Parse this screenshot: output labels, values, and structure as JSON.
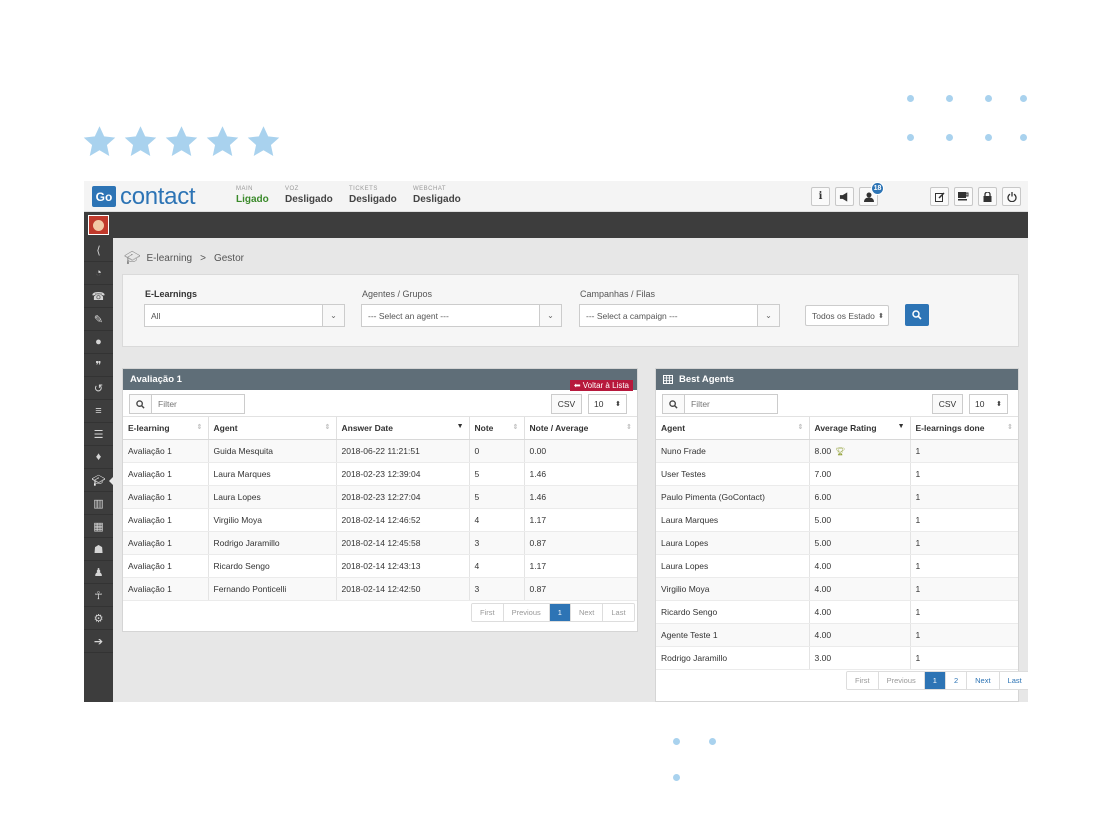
{
  "rating": {
    "stars": 5
  },
  "app": {
    "logo_badge": "Go",
    "logo_text": "contact",
    "statuses": [
      {
        "key": "MAIN",
        "value": "Ligado"
      },
      {
        "key": "VOZ",
        "value": "Desligado"
      },
      {
        "key": "TICKETS",
        "value": "Desligado"
      },
      {
        "key": "WEBCHAT",
        "value": "Desligado"
      }
    ],
    "toolbar": {
      "info_icon": "i",
      "notification_count": "18"
    },
    "accent": "#2d74b5"
  },
  "breadcrumb": {
    "root": "E-learning",
    "sep": ">",
    "current": "Gestor"
  },
  "filters": {
    "elearnings": {
      "label": "E-Learnings",
      "value": "All"
    },
    "agents": {
      "label": "Agentes / Grupos",
      "value": "--- Select an agent ---"
    },
    "campaigns": {
      "label": "Campanhas / Filas",
      "value": "--- Select a campaign ---"
    },
    "state": {
      "value": "Todos os Estado"
    }
  },
  "left_panel": {
    "title": "Avaliação 1",
    "back_label": "⬅ Voltar à Lista",
    "filter_placeholder": "Filter",
    "csv_label": "CSV",
    "page_size": "10",
    "columns": [
      "E-learning",
      "Agent",
      "Answer Date",
      "Note",
      "Note / Average"
    ],
    "rows": [
      [
        "Avaliação 1",
        "Guida Mesquita",
        "2018-06-22 11:21:51",
        "0",
        "0.00"
      ],
      [
        "Avaliação 1",
        "Laura Marques",
        "2018-02-23 12:39:04",
        "5",
        "1.46"
      ],
      [
        "Avaliação 1",
        "Laura Lopes",
        "2018-02-23 12:27:04",
        "5",
        "1.46"
      ],
      [
        "Avaliação 1",
        "Virgilio Moya",
        "2018-02-14 12:46:52",
        "4",
        "1.17"
      ],
      [
        "Avaliação 1",
        "Rodrigo Jaramillo",
        "2018-02-14 12:45:58",
        "3",
        "0.87"
      ],
      [
        "Avaliação 1",
        "Ricardo Sengo",
        "2018-02-14 12:43:13",
        "4",
        "1.17"
      ],
      [
        "Avaliação 1",
        "Fernando Ponticelli",
        "2018-02-14 12:42:50",
        "3",
        "0.87"
      ]
    ],
    "pager": {
      "first": "First",
      "previous": "Previous",
      "pages": [
        "1"
      ],
      "next": "Next",
      "last": "Last"
    }
  },
  "right_panel": {
    "title": "Best Agents",
    "filter_placeholder": "Filter",
    "csv_label": "CSV",
    "page_size": "10",
    "columns": [
      "Agent",
      "Average Rating",
      "E-learnings done"
    ],
    "rows": [
      [
        "Nuno Frade",
        "8.00",
        "1"
      ],
      [
        "User Testes",
        "7.00",
        "1"
      ],
      [
        "Paulo Pimenta (GoContact)",
        "6.00",
        "1"
      ],
      [
        "Laura Marques",
        "5.00",
        "1"
      ],
      [
        "Laura Lopes",
        "5.00",
        "1"
      ],
      [
        "Laura Lopes",
        "4.00",
        "1"
      ],
      [
        "Virgilio Moya",
        "4.00",
        "1"
      ],
      [
        "Ricardo Sengo",
        "4.00",
        "1"
      ],
      [
        "Agente Teste 1",
        "4.00",
        "1"
      ],
      [
        "Rodrigo Jaramillo",
        "3.00",
        "1"
      ]
    ],
    "pager": {
      "first": "First",
      "previous": "Previous",
      "pages": [
        "1",
        "2"
      ],
      "next": "Next",
      "last": "Last"
    }
  }
}
